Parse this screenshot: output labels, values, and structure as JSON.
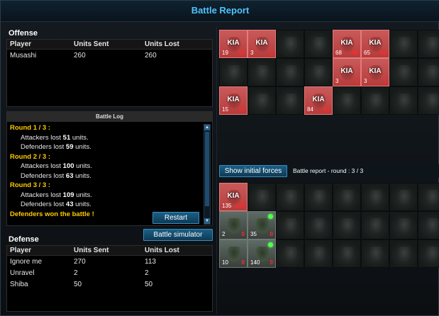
{
  "title": "Battle Report",
  "offense": {
    "label": "Offense",
    "headers": [
      "Player",
      "Units Sent",
      "Units Lost"
    ],
    "rows": [
      {
        "player": "Musashi",
        "sent": "260",
        "lost": "260"
      }
    ]
  },
  "battle_log": {
    "title": "Battle Log",
    "rounds": [
      {
        "round": "Round 1 / 3 :",
        "attackers": "51",
        "defenders": "59"
      },
      {
        "round": "Round 2 / 3 :",
        "attackers": "100",
        "defenders": "63"
      },
      {
        "round": "Round 3 / 3 :",
        "attackers": "109",
        "defenders": "43"
      }
    ],
    "attackers_prefix": "Attackers lost",
    "defenders_prefix": "Defenders lost",
    "suffix": "units.",
    "result": "Defenders won the battle !"
  },
  "buttons": {
    "restart": "Restart",
    "simulator": "Battle simulator",
    "show_initial": "Show initial forces"
  },
  "defense": {
    "label": "Defense",
    "headers": [
      "Player",
      "Units Sent",
      "Units Lost"
    ],
    "rows": [
      {
        "player": "Ignore me",
        "sent": "270",
        "lost": "113"
      },
      {
        "player": "Unravel",
        "sent": "2",
        "lost": "2"
      },
      {
        "player": "Shiba",
        "sent": "50",
        "lost": "50"
      }
    ]
  },
  "round_label": "Battle report - round : 3 / 3",
  "kia_text": "KIA",
  "offense_units": [
    {
      "state": "kia",
      "count": "19",
      "lost": "19"
    },
    {
      "state": "kia",
      "count": "3",
      "lost": "3"
    },
    {
      "state": "empty"
    },
    {
      "state": "empty"
    },
    {
      "state": "kia",
      "count": "68",
      "lost": "68"
    },
    {
      "state": "kia",
      "count": "65",
      "lost": "65"
    },
    {
      "state": "empty"
    },
    {
      "state": "empty"
    },
    {
      "state": "empty"
    },
    {
      "state": "empty"
    },
    {
      "state": "empty"
    },
    {
      "state": "empty"
    },
    {
      "state": "kia",
      "count": "3",
      "lost": "3"
    },
    {
      "state": "kia",
      "count": "3",
      "lost": "3"
    },
    {
      "state": "empty"
    },
    {
      "state": "empty"
    },
    {
      "state": "kia",
      "count": "15",
      "lost": "15"
    },
    {
      "state": "empty"
    },
    {
      "state": "empty"
    },
    {
      "state": "kia",
      "count": "84",
      "lost": "84"
    },
    {
      "state": "empty"
    },
    {
      "state": "empty"
    },
    {
      "state": "empty"
    },
    {
      "state": "empty"
    }
  ],
  "defense_units": [
    {
      "state": "kia",
      "count": "135",
      "lost": "135"
    },
    {
      "state": "empty"
    },
    {
      "state": "empty"
    },
    {
      "state": "empty"
    },
    {
      "state": "empty"
    },
    {
      "state": "empty"
    },
    {
      "state": "empty"
    },
    {
      "state": "empty"
    },
    {
      "state": "alive",
      "count": "2",
      "lost": "0"
    },
    {
      "state": "alive",
      "count": "35",
      "lost": "0",
      "bonus": true
    },
    {
      "state": "empty"
    },
    {
      "state": "empty"
    },
    {
      "state": "empty"
    },
    {
      "state": "empty"
    },
    {
      "state": "empty"
    },
    {
      "state": "empty"
    },
    {
      "state": "alive",
      "count": "10",
      "lost": "0"
    },
    {
      "state": "alive",
      "count": "140",
      "lost": "0",
      "bonus": true
    },
    {
      "state": "empty"
    },
    {
      "state": "empty"
    },
    {
      "state": "empty"
    },
    {
      "state": "empty"
    },
    {
      "state": "empty"
    },
    {
      "state": "empty"
    }
  ]
}
